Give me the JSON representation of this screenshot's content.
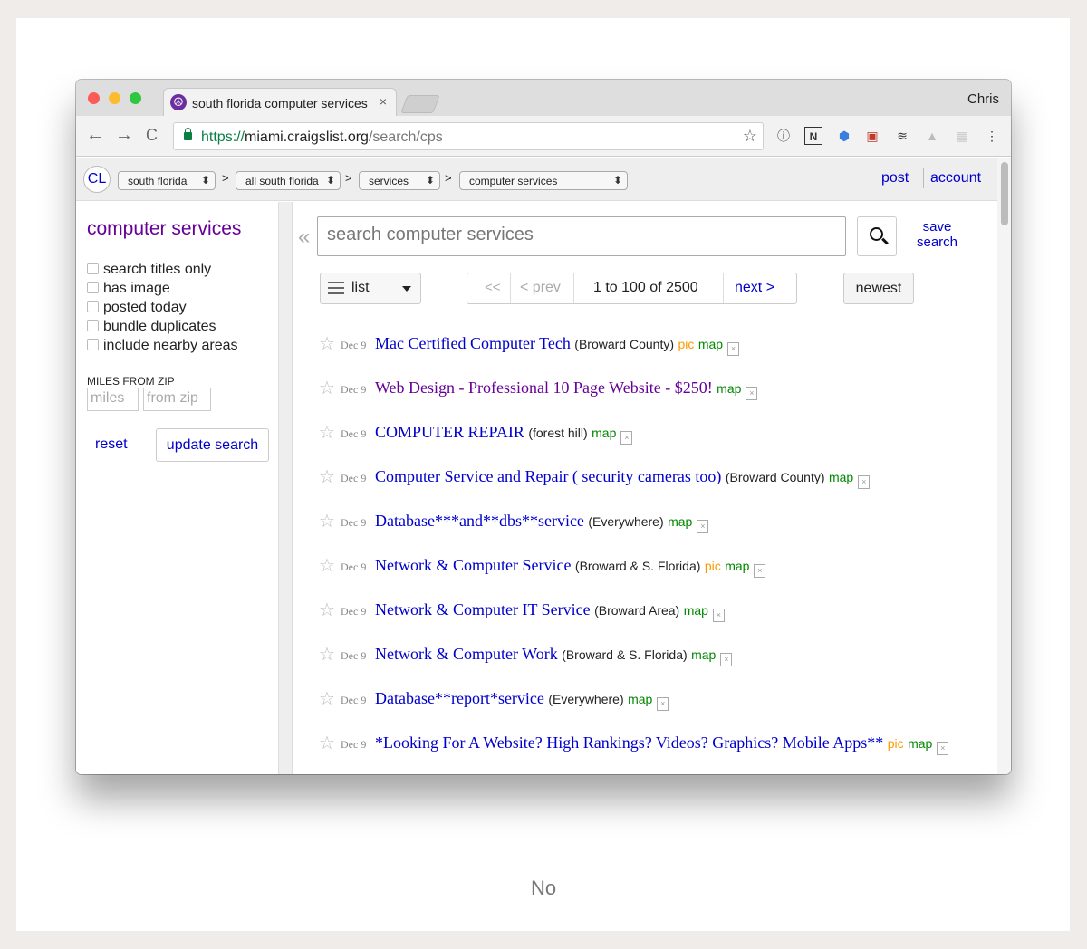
{
  "caption": "No",
  "browser": {
    "tab_title": "south florida computer services",
    "tab_close": "×",
    "profile": "Chris",
    "url_scheme": "https://",
    "url_host": "miami.craigslist.org",
    "url_path": "/search/cps",
    "nav": {
      "back": "←",
      "forward": "→",
      "reload": "C"
    }
  },
  "crumbs": {
    "logo": "CL",
    "selects": [
      "south florida",
      "all south florida",
      "services",
      "computer services"
    ],
    "separator": ">",
    "post": "post",
    "account": "account"
  },
  "sidebar": {
    "title": "computer services",
    "checkboxes": [
      "search titles only",
      "has image",
      "posted today",
      "bundle duplicates",
      "include nearby areas"
    ],
    "miles_label": "MILES FROM ZIP",
    "miles_placeholder": "miles",
    "zip_placeholder": "from zip",
    "reset": "reset",
    "update": "update search"
  },
  "search": {
    "collapse": "«",
    "placeholder": "search computer services",
    "save": "save search"
  },
  "controls": {
    "view": "list",
    "first": "<<",
    "prev": "< prev",
    "range": "1 to 100 of 2500",
    "next": "next >",
    "sort": "newest"
  },
  "listings": [
    {
      "date": "Dec 9",
      "title": "Mac Certified Computer Tech",
      "loc": "(Broward County)",
      "pic": "pic",
      "map": "map",
      "visited": false
    },
    {
      "date": "Dec 9",
      "title": "Web Design - Professional 10 Page Website - $250!",
      "loc": "",
      "pic": "",
      "map": "map",
      "visited": true
    },
    {
      "date": "Dec 9",
      "title": "COMPUTER REPAIR",
      "loc": "(forest hill)",
      "pic": "",
      "map": "map",
      "visited": false
    },
    {
      "date": "Dec 9",
      "title": "Computer Service and Repair ( security cameras too)",
      "loc": "(Broward County)",
      "pic": "",
      "map": "map",
      "visited": false
    },
    {
      "date": "Dec 9",
      "title": "Database***and**dbs**service",
      "loc": "(Everywhere)",
      "pic": "",
      "map": "map",
      "visited": false
    },
    {
      "date": "Dec 9",
      "title": "Network & Computer Service",
      "loc": "(Broward & S. Florida)",
      "pic": "pic",
      "map": "map",
      "visited": false
    },
    {
      "date": "Dec 9",
      "title": "Network & Computer IT Service",
      "loc": "(Broward Area)",
      "pic": "",
      "map": "map",
      "visited": false
    },
    {
      "date": "Dec 9",
      "title": "Network & Computer Work",
      "loc": "(Broward & S. Florida)",
      "pic": "",
      "map": "map",
      "visited": false
    },
    {
      "date": "Dec 9",
      "title": "Database**report*service",
      "loc": "(Everywhere)",
      "pic": "",
      "map": "map",
      "visited": false
    },
    {
      "date": "Dec 9",
      "title": "*Looking For A Website? High Rankings? Videos? Graphics? Mobile Apps**",
      "loc": "",
      "pic": "pic",
      "map": "map",
      "visited": false
    }
  ],
  "colors": {
    "link": "#0000cc",
    "visited": "#660099",
    "map": "#008800",
    "pic": "#ff9900"
  }
}
